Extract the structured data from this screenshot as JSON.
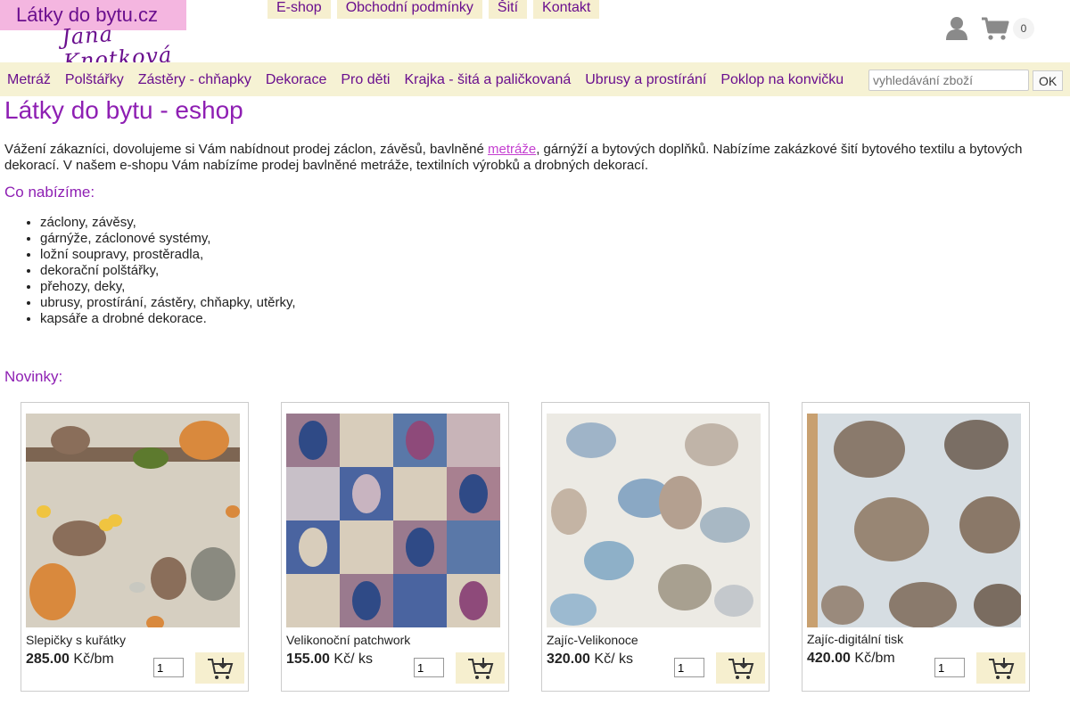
{
  "logo": {
    "title": "Látky do bytu.cz",
    "signature": "Jana Knotková"
  },
  "topnav": [
    "E-shop",
    "Obchodní podmínky",
    "Šití",
    "Kontakt"
  ],
  "header": {
    "user_icon": "user-icon",
    "cart_icon": "cart-icon",
    "cart_count": "0"
  },
  "categories": [
    "Metráž",
    "Polštářky",
    "Zástěry - chňapky",
    "Dekorace",
    "Pro děti",
    "Krajka - šitá a paličkovaná",
    "Ubrusy a prostírání",
    "Poklop na konvičku"
  ],
  "search": {
    "placeholder": "vyhledávání zboží",
    "button": "OK"
  },
  "main": {
    "title": "Látky do bytu - eshop",
    "intro_before": "Vážení zákazníci, dovolujeme si Vám nabídnout prodej záclon, závěsů, bavlněné ",
    "intro_link": "metráže",
    "intro_after": ", gárnýží a bytových doplňků. Nabízíme zakázkové šití bytového textilu a bytových dekorací. V našem e-shopu Vám nabízíme prodej bavlněné metráže, textilních výrobků a drobných dekorací.",
    "offer_heading": "Co nabízíme:",
    "offer_items": [
      "záclony, závěsy,",
      "gárnýže, záclonové systémy,",
      "ložní soupravy, prostěradla,",
      "dekorační polštářky,",
      "přehozy, deky,",
      "ubrusy, prostírání, zástěry, chňapky, utěrky,",
      "kapsáře a drobné dekorace."
    ],
    "news_heading": "Novinky:"
  },
  "products": [
    {
      "name": "Slepičky s kuřátky",
      "price": "285.00",
      "unit": "Kč/bm",
      "qty": "1"
    },
    {
      "name": "Velikonoční patchwork",
      "price": "155.00",
      "unit": "Kč/ ks",
      "qty": "1"
    },
    {
      "name": "Zajíc-Velikonoce",
      "price": "320.00",
      "unit": "Kč/ ks",
      "qty": "1"
    },
    {
      "name": "Zajíc-digitální tisk",
      "price": "420.00",
      "unit": "Kč/bm",
      "qty": "1"
    }
  ],
  "colors": {
    "accent": "#8e1fb3",
    "nav_bg": "#f6efcf",
    "logo_bg": "#f4b6e0"
  }
}
